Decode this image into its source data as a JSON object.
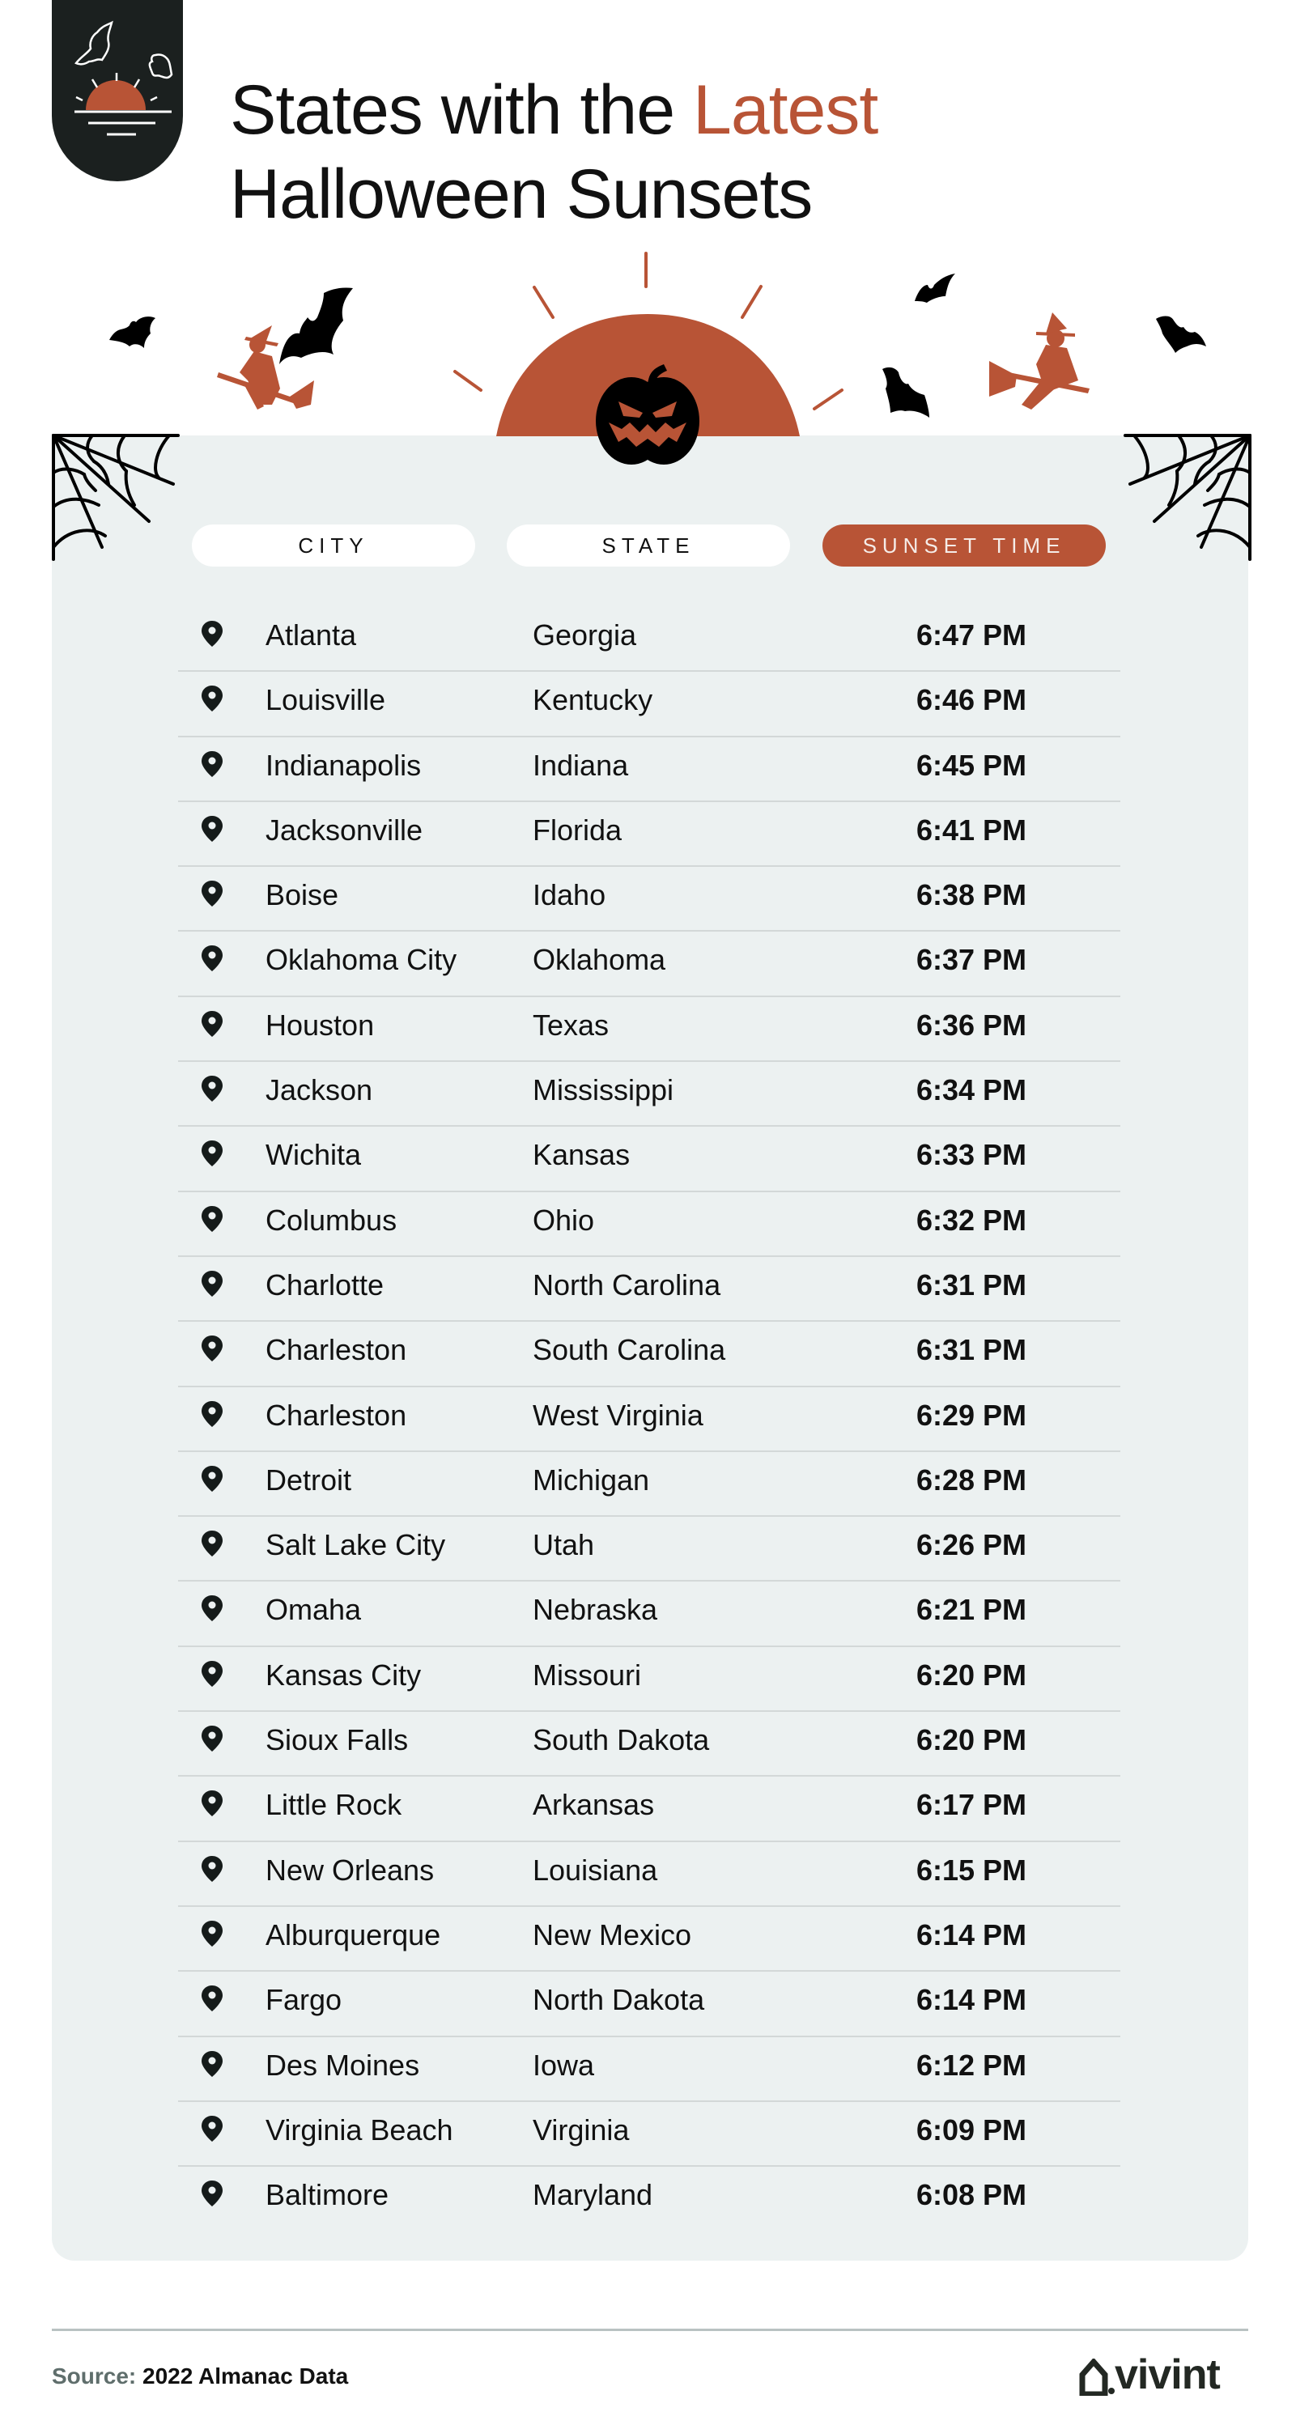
{
  "header": {
    "title_line1_prefix": "States with the ",
    "title_line1_accent": "Latest",
    "title_line2": "Halloween Sunsets",
    "badge_icon": "sunset-bats-icon"
  },
  "decoration": {
    "icons": [
      "bat-icon",
      "witch-on-broom-icon",
      "sun-icon",
      "jack-o-lantern-icon",
      "cobweb-icon"
    ]
  },
  "table": {
    "columns": [
      {
        "label": "CITY",
        "active": false
      },
      {
        "label": "STATE",
        "active": false
      },
      {
        "label": "SUNSET TIME",
        "active": true
      }
    ],
    "rows": [
      {
        "city": "Atlanta",
        "state": "Georgia",
        "time": "6:47 PM"
      },
      {
        "city": "Louisville",
        "state": "Kentucky",
        "time": "6:46 PM"
      },
      {
        "city": "Indianapolis",
        "state": "Indiana",
        "time": "6:45 PM"
      },
      {
        "city": "Jacksonville",
        "state": "Florida",
        "time": "6:41 PM"
      },
      {
        "city": "Boise",
        "state": "Idaho",
        "time": "6:38 PM"
      },
      {
        "city": "Oklahoma City",
        "state": "Oklahoma",
        "time": "6:37 PM"
      },
      {
        "city": "Houston",
        "state": "Texas",
        "time": "6:36 PM"
      },
      {
        "city": "Jackson",
        "state": "Mississippi",
        "time": "6:34 PM"
      },
      {
        "city": "Wichita",
        "state": "Kansas",
        "time": "6:33 PM"
      },
      {
        "city": "Columbus",
        "state": "Ohio",
        "time": "6:32 PM"
      },
      {
        "city": "Charlotte",
        "state": "North Carolina",
        "time": "6:31 PM"
      },
      {
        "city": "Charleston",
        "state": "South Carolina",
        "time": "6:31 PM"
      },
      {
        "city": "Charleston",
        "state": "West Virginia",
        "time": "6:29 PM"
      },
      {
        "city": "Detroit",
        "state": "Michigan",
        "time": "6:28 PM"
      },
      {
        "city": "Salt Lake City",
        "state": "Utah",
        "time": "6:26 PM"
      },
      {
        "city": "Omaha",
        "state": "Nebraska",
        "time": "6:21 PM"
      },
      {
        "city": "Kansas City",
        "state": "Missouri",
        "time": "6:20 PM"
      },
      {
        "city": "Sioux Falls",
        "state": "South Dakota",
        "time": "6:20 PM"
      },
      {
        "city": "Little Rock",
        "state": "Arkansas",
        "time": "6:17 PM"
      },
      {
        "city": "New Orleans",
        "state": "Louisiana",
        "time": "6:15 PM"
      },
      {
        "city": "Alburquerque",
        "state": "New Mexico",
        "time": "6:14 PM"
      },
      {
        "city": "Fargo",
        "state": "North Dakota",
        "time": "6:14 PM"
      },
      {
        "city": "Des Moines",
        "state": "Iowa",
        "time": "6:12 PM"
      },
      {
        "city": "Virginia Beach",
        "state": "Virginia",
        "time": "6:09 PM"
      },
      {
        "city": "Baltimore",
        "state": "Maryland",
        "time": "6:08 PM"
      }
    ]
  },
  "footer": {
    "source_label": "Source:",
    "source_value": " 2022 Almanac Data",
    "brand": "vivint"
  },
  "colors": {
    "accent": "#b85436",
    "dark": "#1b201f",
    "card_bg": "#ecf1f1"
  }
}
